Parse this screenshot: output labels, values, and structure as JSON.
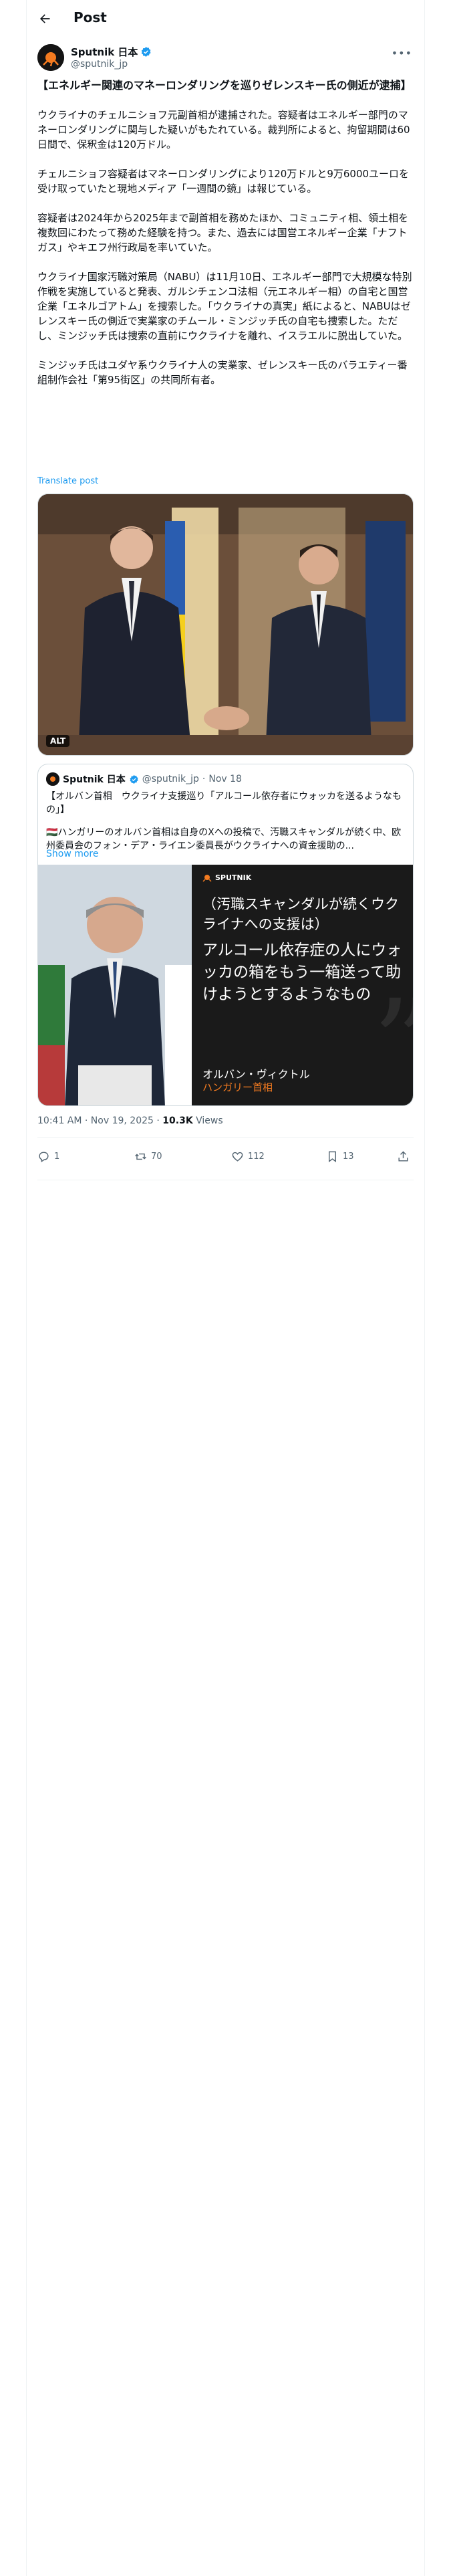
{
  "header": {
    "title": "Post"
  },
  "author": {
    "name": "Sputnik 日本",
    "handle": "@sputnik_jp",
    "avatar_text": "SP"
  },
  "post": {
    "title": "【エネルギー関連のマネーロンダリングを巡りゼレンスキー氏の側近が逮捕】",
    "paragraphs": [
      "ウクライナのチェルニショフ元副首相が逮捕された。容疑者はエネルギー部門のマネーロンダリングに関与した疑いがもたれている。裁判所によると、拘留期間は60日間で、保釈金は120万ドル。",
      "チェルニショフ容疑者はマネーロンダリングにより120万ドルと9万6000ユーロを受け取っていたと現地メディア「一週間の鏡」は報じている。",
      "容疑者は2024年から2025年まで副首相を務めたほか、コミュニティ相、領土相を複数回にわたって務めた経験を持つ。また、過去には国営エネルギー企業「ナフトガス」やキエフ州行政局を率いていた。",
      "ウクライナ国家汚職対策局（NABU）は11月10日、エネルギー部門で大規模な特別作戦を実施していると発表、ガルシチェンコ法相（元エネルギー相）の自宅と国営企業「エネルゴアトム」を捜索した。「ウクライナの真実」紙によると、NABUはゼレンスキー氏の側近で実業家のチムール・ミンジッチ氏の自宅も捜索した。ただし、ミンジッチ氏は捜索の直前にウクライナを離れ、イスラエルに脱出していた。",
      "ミンジッチ氏はユダヤ系ウクライナ人の実業家、ゼレンスキー氏のバラエティー番組制作会社「第95街区」の共同所有者。"
    ],
    "translate_label": "Translate post",
    "media_alt_badge": "ALT",
    "timestamp": "10:41 AM · Nov 19, 2025 · ",
    "views_count": "10.3K",
    "views_label": " Views"
  },
  "quote": {
    "name": "Sputnik 日本",
    "handle": "@sputnik_jp",
    "separator": "·",
    "date": "Nov 18",
    "line1": "【オルバン首相　ウクライナ支援巡り「アルコール依存者にウォッカを送るようなもの」】",
    "line2": "🇭🇺ハンガリーのオルバン首相は自身のXへの投稿で、汚職スキャンダルが続く中、欧州委員会のフォン・デア・ライエン委員長がウクライナへの資金援助の...",
    "show_more": "Show more",
    "card": {
      "brand": "SPUTNIK",
      "headline1": "（汚職スキャンダルが続くウクライナへの支援は）",
      "headline2": "アルコール依存症の人にウォッカの箱をもう一箱送って助けようとするようなもの",
      "speaker": "オルバン・ヴィクトル",
      "speaker_title": "ハンガリー首相"
    }
  },
  "actions": {
    "replies": "1",
    "reposts": "70",
    "likes": "112",
    "bookmarks": "13"
  },
  "colors": {
    "accent": "#1d9bf0",
    "sputnik_orange": "#f47b20",
    "text_secondary": "#536471"
  }
}
